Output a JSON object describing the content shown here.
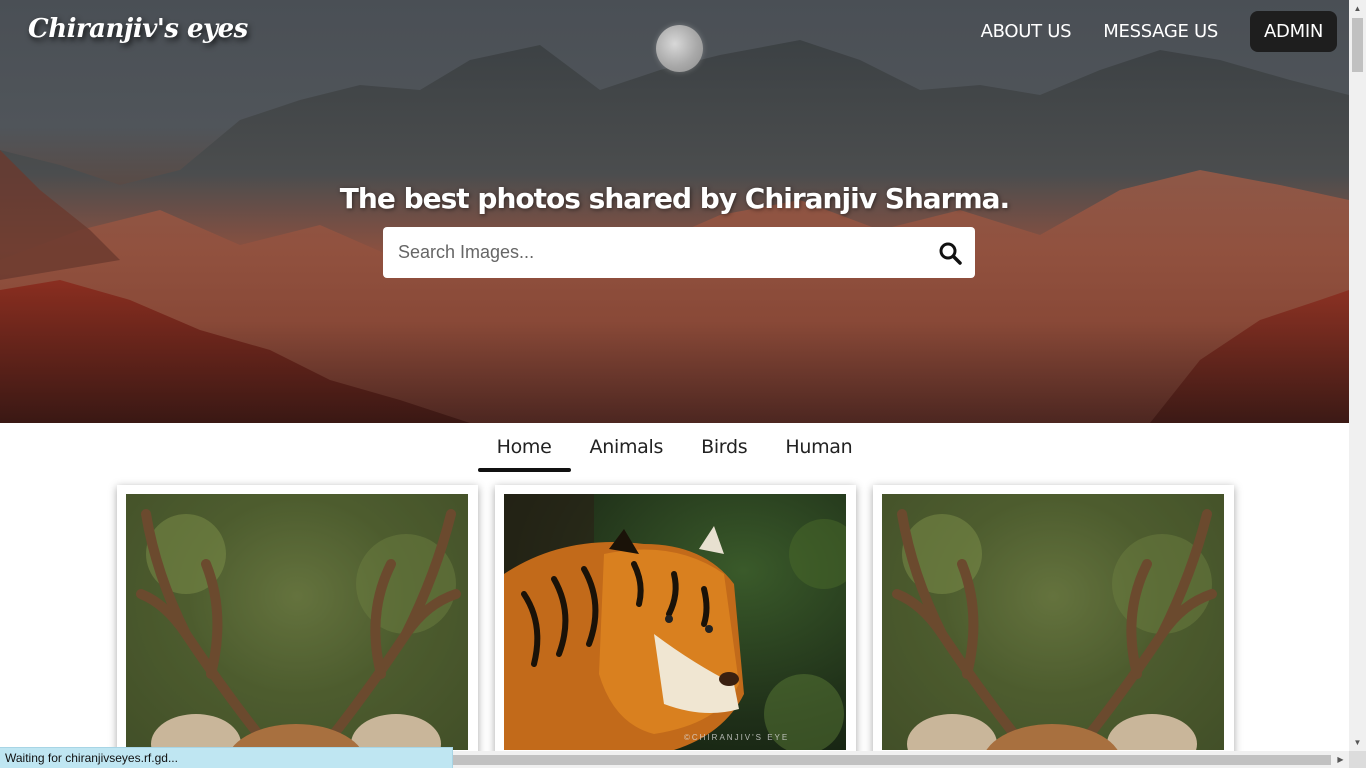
{
  "header": {
    "brand": "Chiranjiv's eyes",
    "nav": {
      "about": "ABOUT US",
      "message": "MESSAGE US",
      "admin": "ADMIN"
    }
  },
  "hero": {
    "tagline": "The best photos shared by Chiranjiv Sharma.",
    "search_placeholder": "Search Images..."
  },
  "tabs": [
    "Home",
    "Animals",
    "Birds",
    "Human"
  ],
  "gallery": [
    {
      "subject": "deer"
    },
    {
      "subject": "tiger",
      "watermark": "©CHIRANJIV'S EYE"
    },
    {
      "subject": "deer"
    }
  ],
  "status_text": "Waiting for chiranjivseyes.rf.gd...",
  "icons": {
    "search": "search-icon"
  }
}
